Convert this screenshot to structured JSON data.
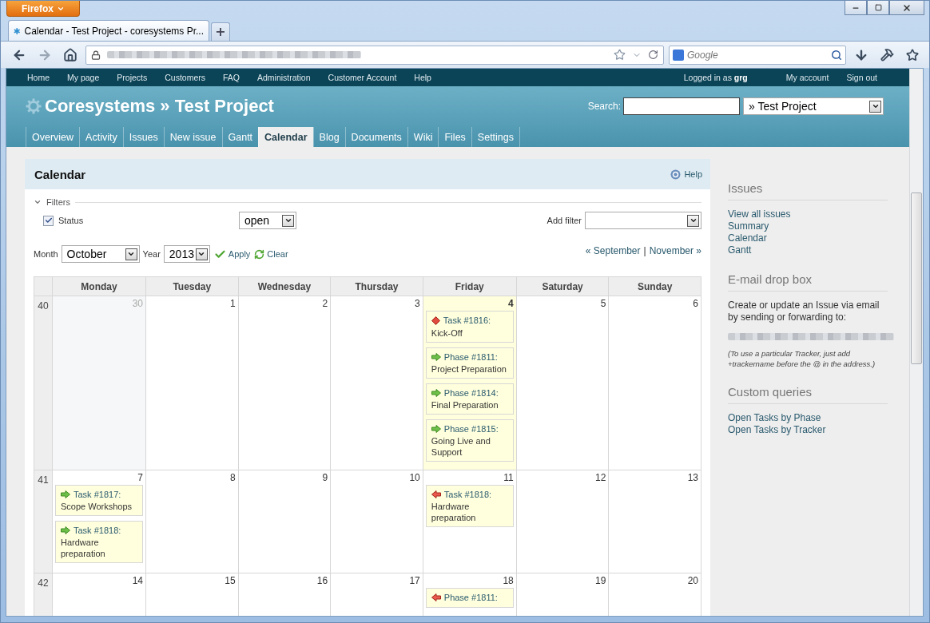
{
  "browser": {
    "menu_button": "Firefox",
    "tab_title": "Calendar - Test Project - coresystems Pr...",
    "new_tab": "+",
    "search_placeholder": "Google"
  },
  "top_menu": {
    "items": [
      "Home",
      "My page",
      "Projects",
      "Customers",
      "FAQ",
      "Administration",
      "Customer Account",
      "Help"
    ],
    "logged_in_label": "Logged in as",
    "user": "grg",
    "account_links": [
      "My account",
      "Sign out"
    ]
  },
  "header": {
    "title": "Coresystems » Test Project",
    "search_label": "Search:",
    "project_select": "» Test Project"
  },
  "tabs": [
    {
      "label": "Overview",
      "selected": false
    },
    {
      "label": "Activity",
      "selected": false
    },
    {
      "label": "Issues",
      "selected": false
    },
    {
      "label": "New issue",
      "selected": false
    },
    {
      "label": "Gantt",
      "selected": false
    },
    {
      "label": "Calendar",
      "selected": true
    },
    {
      "label": "Blog",
      "selected": false
    },
    {
      "label": "Documents",
      "selected": false
    },
    {
      "label": "Wiki",
      "selected": false
    },
    {
      "label": "Files",
      "selected": false
    },
    {
      "label": "Settings",
      "selected": false
    }
  ],
  "content": {
    "title": "Calendar",
    "help": "Help",
    "filters": {
      "legend": "Filters",
      "status_label": "Status",
      "status_checked": true,
      "status_value": "open",
      "add_filter_label": "Add filter"
    },
    "month_label": "Month",
    "month": "October",
    "year_label": "Year",
    "year": "2013",
    "apply": "Apply",
    "clear": "Clear",
    "prev": "« September",
    "separator": "|",
    "next": "November »"
  },
  "calendar": {
    "day_names": [
      "Monday",
      "Tuesday",
      "Wednesday",
      "Thursday",
      "Friday",
      "Saturday",
      "Sunday"
    ],
    "weeks": [
      {
        "number": "40",
        "days": [
          {
            "date": "30",
            "outside_month": true,
            "today": false
          },
          {
            "date": "1",
            "outside_month": false,
            "today": false
          },
          {
            "date": "2",
            "outside_month": false,
            "today": false
          },
          {
            "date": "3",
            "outside_month": false,
            "today": false
          },
          {
            "date": "4",
            "outside_month": false,
            "today": true,
            "events": [
              {
                "kind": "both",
                "link": "Task #1816:",
                "subject": "Kick-Off"
              },
              {
                "kind": "start",
                "link": "Phase #1811:",
                "subject": "Project Preparation"
              },
              {
                "kind": "start",
                "link": "Phase #1814:",
                "subject": "Final Preparation"
              },
              {
                "kind": "start",
                "link": "Phase #1815:",
                "subject": "Going Live and Support"
              }
            ]
          },
          {
            "date": "5",
            "outside_month": false,
            "today": false
          },
          {
            "date": "6",
            "outside_month": false,
            "today": false
          }
        ]
      },
      {
        "number": "41",
        "days": [
          {
            "date": "7",
            "outside_month": false,
            "today": false,
            "events": [
              {
                "kind": "start",
                "link": "Task #1817:",
                "subject": "Scope Workshops"
              },
              {
                "kind": "start",
                "link": "Task #1818:",
                "subject": "Hardware preparation"
              }
            ]
          },
          {
            "date": "8",
            "outside_month": false,
            "today": false
          },
          {
            "date": "9",
            "outside_month": false,
            "today": false
          },
          {
            "date": "10",
            "outside_month": false,
            "today": false
          },
          {
            "date": "11",
            "outside_month": false,
            "today": false,
            "events": [
              {
                "kind": "end",
                "link": "Task #1818:",
                "subject": "Hardware preparation"
              }
            ]
          },
          {
            "date": "12",
            "outside_month": false,
            "today": false
          },
          {
            "date": "13",
            "outside_month": false,
            "today": false
          }
        ]
      },
      {
        "number": "42",
        "days": [
          {
            "date": "14",
            "outside_month": false,
            "today": false
          },
          {
            "date": "15",
            "outside_month": false,
            "today": false
          },
          {
            "date": "16",
            "outside_month": false,
            "today": false
          },
          {
            "date": "17",
            "outside_month": false,
            "today": false
          },
          {
            "date": "18",
            "outside_month": false,
            "today": false,
            "events": [
              {
                "kind": "end",
                "link": "Phase #1811:"
              }
            ]
          },
          {
            "date": "19",
            "outside_month": false,
            "today": false
          },
          {
            "date": "20",
            "outside_month": false,
            "today": false
          }
        ]
      }
    ]
  },
  "sidebar": {
    "issues": {
      "title": "Issues",
      "links": [
        "View all issues",
        "Summary",
        "Calendar",
        "Gantt"
      ]
    },
    "email_drop_box": {
      "title": "E-mail drop box",
      "text": "Create or update an Issue via email by sending or forwarding to:",
      "note": "(To use a particular Tracker, just add +trackername before the @ in the address.)"
    },
    "custom_queries": {
      "title": "Custom queries",
      "links": [
        "Open Tasks by Phase",
        "Open Tasks by Tracker"
      ]
    }
  }
}
